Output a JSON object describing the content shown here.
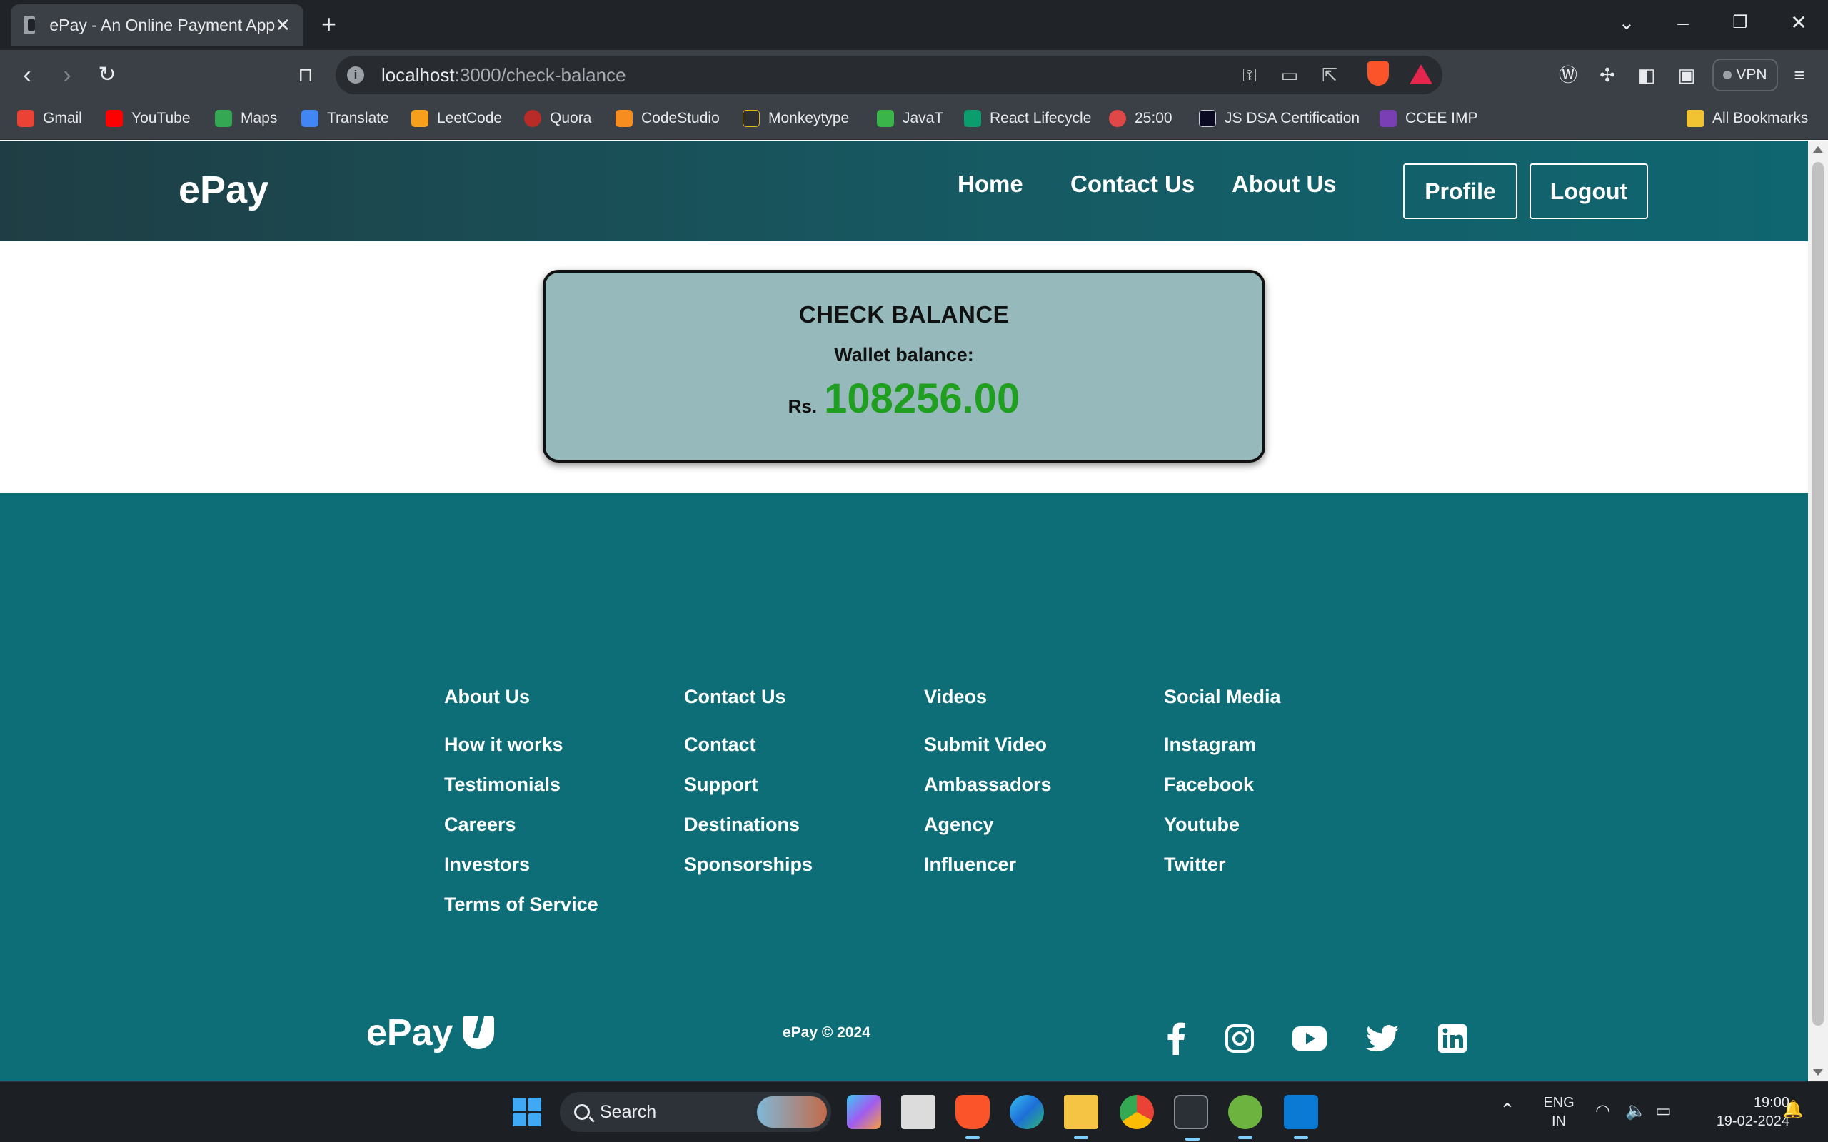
{
  "browser": {
    "tab_title": "ePay - An Online Payment App",
    "url_host": "localhost",
    "url_path": ":3000/check-balance",
    "vpn_label": "VPN",
    "bookmarks": [
      {
        "label": "Gmail",
        "color": "#ea4335"
      },
      {
        "label": "YouTube",
        "color": "#ff0000"
      },
      {
        "label": "Maps",
        "color": "#34a853"
      },
      {
        "label": "Translate",
        "color": "#4285f4"
      },
      {
        "label": "LeetCode",
        "color": "#f89f1b"
      },
      {
        "label": "Quora",
        "color": "#b92b27"
      },
      {
        "label": "CodeStudio",
        "color": "#f78d1e"
      },
      {
        "label": "Monkeytype",
        "color": "#2c2e31"
      },
      {
        "label": "JavaT",
        "color": "#3ab54a"
      },
      {
        "label": "React Lifecycle",
        "color": "#0b9e6c"
      },
      {
        "label": "25:00",
        "color": "#e04848"
      },
      {
        "label": "JS DSA Certification",
        "color": "#0a0a23"
      },
      {
        "label": "CCEE IMP",
        "color": "#7b3fb5"
      }
    ],
    "all_bookmarks_label": "All Bookmarks"
  },
  "header": {
    "brand": "ePay",
    "nav": [
      "Home",
      "Contact Us",
      "About Us"
    ],
    "profile_label": "Profile",
    "logout_label": "Logout"
  },
  "balance": {
    "title": "CHECK BALANCE",
    "label": "Wallet balance:",
    "currency": "Rs.",
    "amount": "108256.00",
    "amount_color": "#1f9e1f"
  },
  "footer": {
    "columns": [
      {
        "heading": "About Us",
        "links": [
          "How it works",
          "Testimonials",
          "Careers",
          "Investors",
          "Terms of Service"
        ]
      },
      {
        "heading": "Contact Us",
        "links": [
          "Contact",
          "Support",
          "Destinations",
          "Sponsorships"
        ]
      },
      {
        "heading": "Videos",
        "links": [
          "Submit Video",
          "Ambassadors",
          "Agency",
          "Influencer"
        ]
      },
      {
        "heading": "Social Media",
        "links": [
          "Instagram",
          "Facebook",
          "Youtube",
          "Twitter"
        ]
      }
    ],
    "brand": "ePay",
    "copyright": "ePay © 2024",
    "social_icons": [
      "facebook-icon",
      "instagram-icon",
      "youtube-icon",
      "twitter-icon",
      "linkedin-icon"
    ],
    "bg_color": "#0e6e77"
  },
  "taskbar": {
    "search_placeholder": "Search",
    "lang_line1": "ENG",
    "lang_line2": "IN",
    "time": "19:00",
    "date": "19-02-2024"
  }
}
